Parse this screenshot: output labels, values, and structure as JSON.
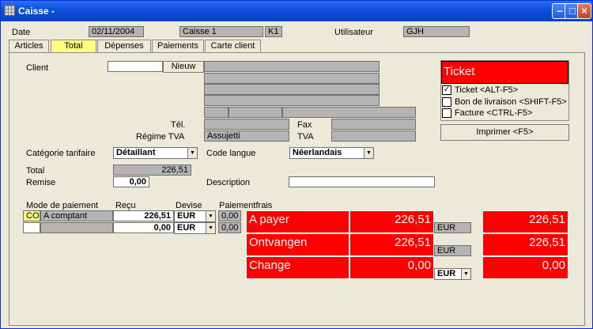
{
  "window": {
    "title": "Caisse -",
    "min_glyph": "–",
    "max_glyph": "□",
    "close_glyph": "×"
  },
  "header": {
    "date_label": "Date",
    "date_value": "02/11/2004",
    "caisse_value": "Caisse 1",
    "caisse_code": "K1",
    "user_label": "Utilisateur",
    "user_value": "GJH"
  },
  "tabs": [
    {
      "label": "Articles",
      "active": false
    },
    {
      "label": "Total",
      "active": true
    },
    {
      "label": "Dépenses",
      "active": false
    },
    {
      "label": "Paiements",
      "active": false
    },
    {
      "label": "Carte client",
      "active": false
    }
  ],
  "client": {
    "label": "Client",
    "value": "",
    "new_button": "Nieuw",
    "tel_label": "Tél.",
    "fax_label": "Fax",
    "regime_label": "Régime TVA",
    "regime_value": "Assujetti",
    "tva_label": "TVA"
  },
  "pricing": {
    "category_label": "Catégorie tarifaire",
    "category_value": "Détaillant",
    "language_label": "Code langue",
    "language_value": "Néerlandais"
  },
  "totals": {
    "total_label": "Total",
    "total_value": "226,51",
    "remise_label": "Remise",
    "remise_value": "0,00",
    "description_label": "Description",
    "description_value": ""
  },
  "payments": {
    "col_mode": "Mode de paiement",
    "col_recu": "Reçu",
    "col_devise": "Devise",
    "col_frais": "Paiementfrais",
    "rows": [
      {
        "code": "CO",
        "mode": "A comptant",
        "recu": "226,51",
        "devise": "EUR",
        "frais": "0,00"
      },
      {
        "code": "",
        "mode": "",
        "recu": "0,00",
        "devise": "EUR",
        "frais": "0,00"
      }
    ]
  },
  "summary": {
    "a_payer_label": "A payer",
    "a_payer_value": "226,51",
    "a_payer_currency": "EUR",
    "a_payer_total": "226,51",
    "ontvangen_label": "Ontvangen",
    "ontvangen_value": "226,51",
    "ontvangen_currency": "EUR",
    "ontvangen_total": "226,51",
    "change_label": "Change",
    "change_value": "0,00",
    "change_currency": "EUR",
    "change_total": "0,00"
  },
  "ticket": {
    "title": "Ticket",
    "options": [
      {
        "label": "Ticket <ALT-F5>",
        "checked": true
      },
      {
        "label": "Bon de livraison <SHIFT-F5>",
        "checked": false
      },
      {
        "label": "Facture <CTRL-F5>",
        "checked": false
      }
    ],
    "print_button": "Imprimer <F5>"
  },
  "colors": {
    "accent_red": "#ff0000",
    "active_tab": "#ffff80",
    "titlebar": "#0a4fd8"
  }
}
